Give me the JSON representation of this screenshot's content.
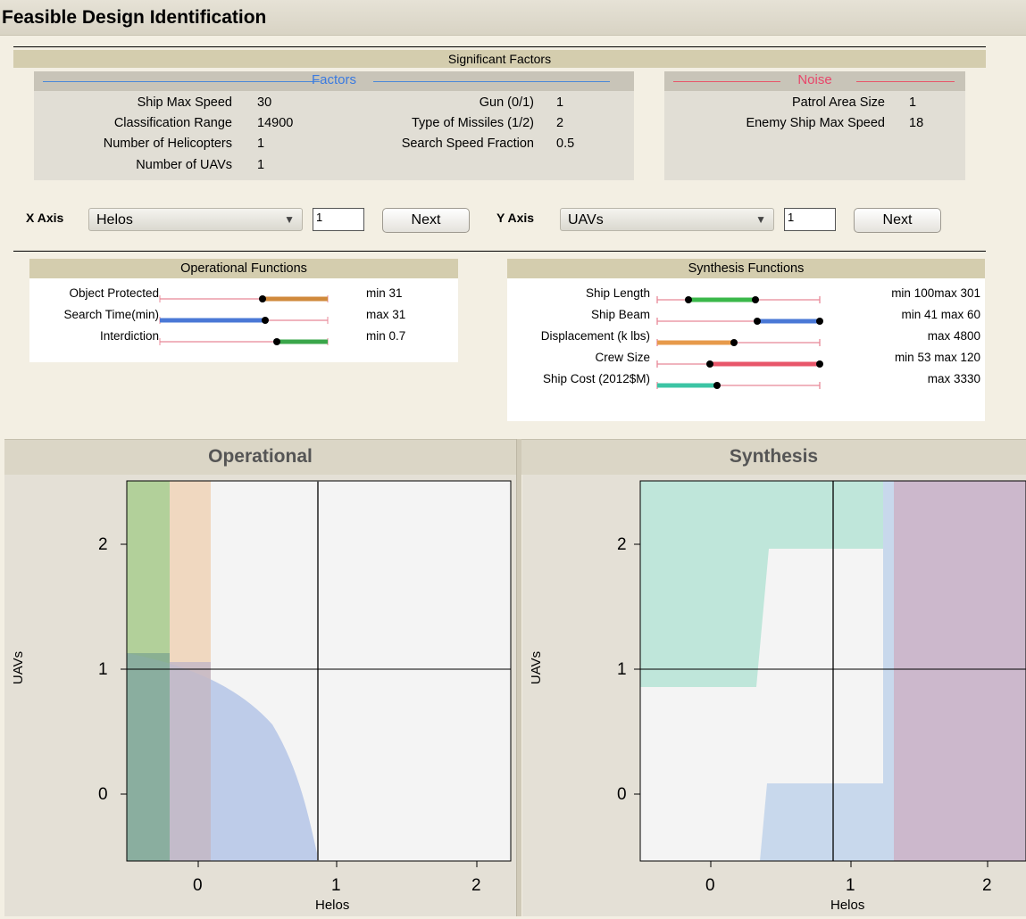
{
  "title": "Feasible Design Identification",
  "significant_factors": {
    "header": "Significant Factors",
    "factors_label": "Factors",
    "noise_label": "Noise",
    "factors_left": [
      {
        "name": "Ship Max Speed",
        "value": "30"
      },
      {
        "name": "Classification Range",
        "value": "14900"
      },
      {
        "name": "Number of Helicopters",
        "value": "1"
      },
      {
        "name": "Number of UAVs",
        "value": "1"
      }
    ],
    "factors_right": [
      {
        "name": "Gun (0/1)",
        "value": "1"
      },
      {
        "name": "Type of Missiles (1/2)",
        "value": "2"
      },
      {
        "name": "Search Speed Fraction",
        "value": "0.5"
      }
    ],
    "noise": [
      {
        "name": "Patrol Area Size",
        "value": "1"
      },
      {
        "name": "Enemy Ship Max Speed",
        "value": "18"
      }
    ]
  },
  "axes": {
    "x_label": "X Axis",
    "x_value": "Helos",
    "x_step": "1",
    "x_next": "Next",
    "y_label": "Y Axis",
    "y_value": "UAVs",
    "y_step": "1",
    "y_next": "Next"
  },
  "operational_functions": {
    "header": "Operational Functions",
    "rows": [
      {
        "name": "Object Protected",
        "bound": "min  31",
        "color": "#d08a3c",
        "level": 0.61
      },
      {
        "name": "Search Time(min)",
        "bound": "max  31",
        "color": "#4a78d6",
        "level": 0.62
      },
      {
        "name": "Interdiction",
        "bound": "min  0.7",
        "color": "#3aa64a",
        "level": 0.7
      }
    ]
  },
  "synthesis_functions": {
    "header": "Synthesis Functions",
    "rows": [
      {
        "name": "Ship Length",
        "bound": "min  100max  301",
        "color": "#3ab84a"
      },
      {
        "name": "Ship Beam",
        "bound": "min  41  max  60",
        "color": "#4a78d6"
      },
      {
        "name": "Displacement (k lbs)",
        "bound": "max  4800",
        "color": "#e79a4a"
      },
      {
        "name": "Crew Size",
        "bound": "min  53  max  120",
        "color": "#e8566a"
      },
      {
        "name": "Ship Cost (2012$M)",
        "bound": "max  3330",
        "color": "#3cc4a4"
      }
    ]
  },
  "plots": {
    "operational_title": "Operational",
    "synthesis_title": "Synthesis",
    "x_axis_label": "Helos",
    "y_axis_label": "UAVs",
    "x_ticks": [
      "0",
      "1",
      "2"
    ],
    "y_ticks": [
      "2",
      "1",
      "0"
    ]
  },
  "chart_data": [
    {
      "type": "area",
      "title": "Operational",
      "xlabel": "Helos",
      "ylabel": "UAVs",
      "xlim": [
        -0.5,
        2.2
      ],
      "ylim": [
        -0.5,
        2.5
      ],
      "crosshair": {
        "x": 0.85,
        "y": 1
      },
      "regions": [
        {
          "color": "#a8d090",
          "x_range": [
            -0.5,
            -0.2
          ]
        },
        {
          "color": "#f2d2b4",
          "x_range": [
            -0.2,
            0.1
          ]
        },
        {
          "color": "#b4c4e6",
          "boundary": [
            [
              -0.5,
              1.12
            ],
            [
              0.0,
              1.02
            ],
            [
              0.3,
              0.85
            ],
            [
              0.55,
              0.6
            ],
            [
              0.75,
              0.15
            ],
            [
              0.85,
              -0.5
            ]
          ]
        }
      ]
    },
    {
      "type": "area",
      "title": "Synthesis",
      "xlabel": "Helos",
      "ylabel": "UAVs",
      "xlim": [
        -0.5,
        2.2
      ],
      "ylim": [
        -0.5,
        2.5
      ],
      "crosshair": {
        "x": 0.87,
        "y": 1
      },
      "regions": [
        {
          "color": "#bfe6da",
          "name": "Ship Cost"
        },
        {
          "color": "#c8d8ec",
          "name": "Ship Beam"
        },
        {
          "color": "#ccb8cc",
          "x_range": [
            1.3,
            2.2
          ]
        }
      ]
    }
  ]
}
